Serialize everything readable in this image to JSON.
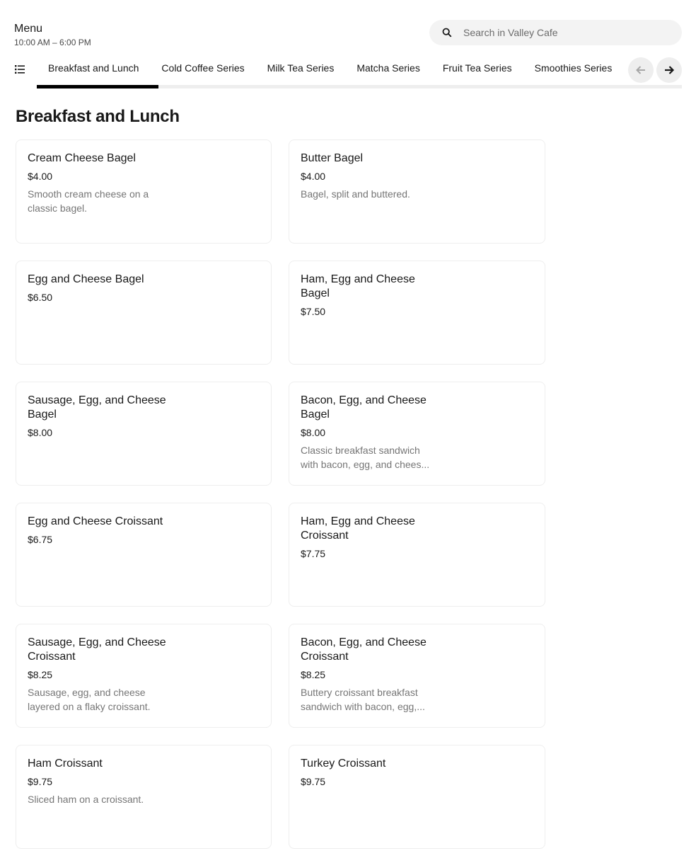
{
  "header": {
    "title": "Menu",
    "hours": "10:00 AM – 6:00 PM"
  },
  "search": {
    "placeholder": "Search in Valley Cafe",
    "value": "",
    "icon": "search-icon"
  },
  "tabs": [
    {
      "label": "Breakfast and Lunch",
      "active": true
    },
    {
      "label": "Cold Coffee Series"
    },
    {
      "label": "Milk Tea Series"
    },
    {
      "label": "Matcha Series"
    },
    {
      "label": "Fruit Tea Series"
    },
    {
      "label": "Smoothies Series"
    }
  ],
  "nav": {
    "prev_icon": "arrow-left-icon",
    "next_icon": "arrow-right-icon",
    "menu_icon": "list-icon"
  },
  "section": {
    "title": "Breakfast and Lunch"
  },
  "items": [
    {
      "name": "Cream Cheese Bagel",
      "price": "$4.00",
      "desc": "Smooth cream cheese on a classic bagel."
    },
    {
      "name": "Butter Bagel",
      "price": "$4.00",
      "desc": "Bagel, split and buttered."
    },
    {
      "name": "Egg and Cheese Bagel",
      "price": "$6.50",
      "desc": ""
    },
    {
      "name": "Ham, Egg and Cheese Bagel",
      "price": "$7.50",
      "desc": ""
    },
    {
      "name": "Sausage, Egg, and Cheese Bagel",
      "price": "$8.00",
      "desc": ""
    },
    {
      "name": "Bacon, Egg, and Cheese Bagel",
      "price": "$8.00",
      "desc": "Classic breakfast sandwich with bacon, egg, and chees..."
    },
    {
      "name": "Egg and Cheese Croissant",
      "price": "$6.75",
      "desc": ""
    },
    {
      "name": "Ham, Egg and Cheese Croissant",
      "price": "$7.75",
      "desc": ""
    },
    {
      "name": "Sausage, Egg, and Cheese Croissant",
      "price": "$8.25",
      "desc": "Sausage, egg, and cheese layered on a flaky croissant."
    },
    {
      "name": "Bacon, Egg, and Cheese Croissant",
      "price": "$8.25",
      "desc": "Buttery croissant breakfast sandwich with bacon, egg,..."
    },
    {
      "name": "Ham Croissant",
      "price": "$9.75",
      "desc": "Sliced ham on a croissant."
    },
    {
      "name": "Turkey Croissant",
      "price": "$9.75",
      "desc": ""
    }
  ],
  "colors": {
    "text": "#191919",
    "muted": "#767676",
    "border": "#eeeeee",
    "indicator": "#000000",
    "search_bg": "#f3f3f3"
  }
}
